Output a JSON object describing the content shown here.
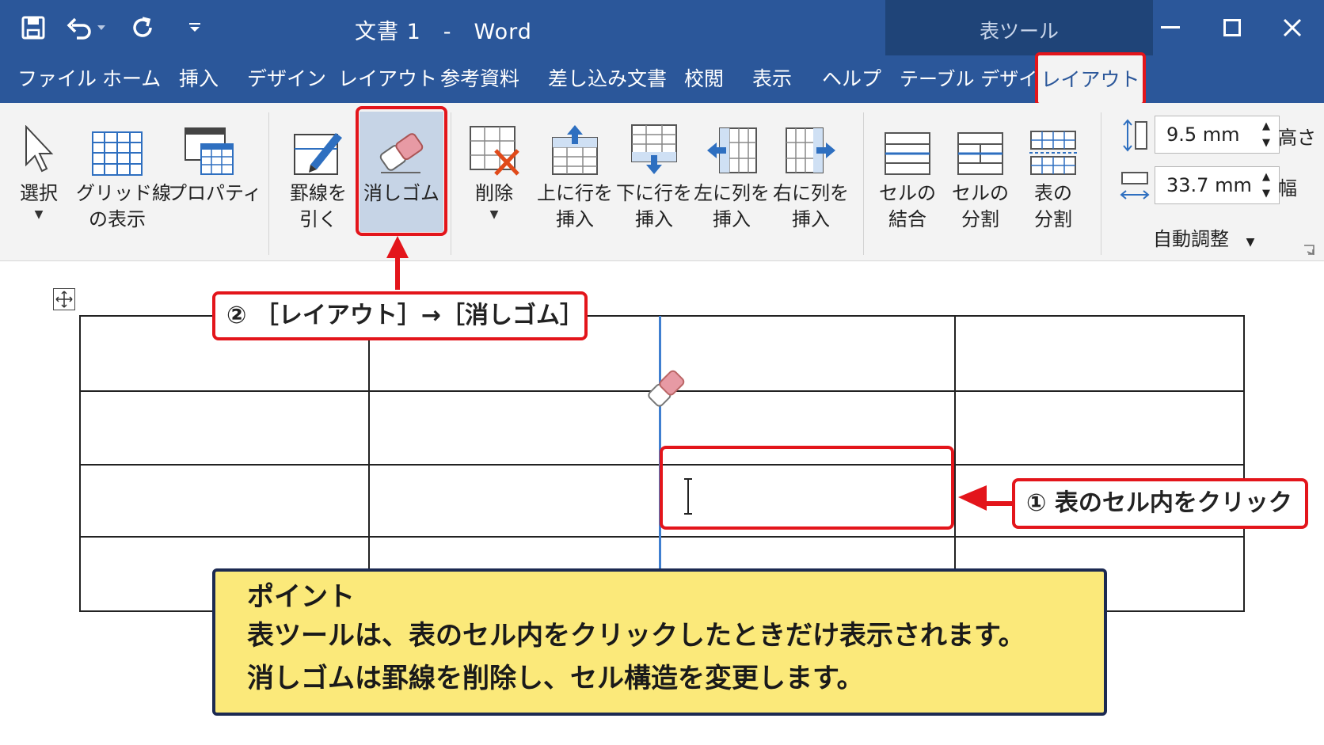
{
  "title_bar": {
    "document_title": "文書 1　-　Word",
    "table_tools_label": "表ツール",
    "quick_access_icons": [
      "save-icon",
      "undo-icon",
      "redo-icon",
      "customize-quick-access-icon"
    ],
    "window_buttons": [
      "minimize-icon",
      "maximize-icon",
      "close-icon"
    ]
  },
  "tabs": [
    "ファイル",
    "ホーム",
    "挿入",
    "デザイン",
    "レイアウト",
    "参考資料",
    "差し込み文書",
    "校閲",
    "表示",
    "ヘルプ"
  ],
  "context_tabs": {
    "table_design": "テーブル デザイン",
    "layout": "レイアウト"
  },
  "ribbon": {
    "select": {
      "line1": "選択"
    },
    "gridlines": {
      "line1": "グリッド線",
      "line2": "の表示"
    },
    "properties": {
      "line1": "プロパティ"
    },
    "draw_table": {
      "line1": "罫線を",
      "line2": "引く"
    },
    "eraser": {
      "line1": "消しゴム"
    },
    "delete": {
      "line1": "削除"
    },
    "insert_above": {
      "line1": "上に行を",
      "line2": "挿入"
    },
    "insert_below": {
      "line1": "下に行を",
      "line2": "挿入"
    },
    "insert_left": {
      "line1": "左に列を",
      "line2": "挿入"
    },
    "insert_right": {
      "line1": "右に列を",
      "line2": "挿入"
    },
    "merge_cells": {
      "line1": "セルの",
      "line2": "結合"
    },
    "split_cells": {
      "line1": "セルの",
      "line2": "分割"
    },
    "split_table": {
      "line1": "表の",
      "line2": "分割"
    },
    "height": {
      "value": "9.5 mm",
      "label": "高さ"
    },
    "width": {
      "value": "33.7 mm",
      "label": "幅"
    },
    "autofit": "自動調整"
  },
  "annotations": {
    "step2": "② ［レイアウト］→［消しゴム］",
    "step1": "① 表のセル内をクリック",
    "point_title": "ポイント",
    "point_lines": [
      "表ツールは、表のセル内をクリックしたときだけ表示されます。",
      "消しゴムは罫線を削除し、セル構造を変更します。"
    ]
  },
  "colors": {
    "word_blue": "#2b579a",
    "highlight_red": "#e3151b",
    "point_yellow": "#fbe97a",
    "eraser_pink": "#e79aa4"
  }
}
